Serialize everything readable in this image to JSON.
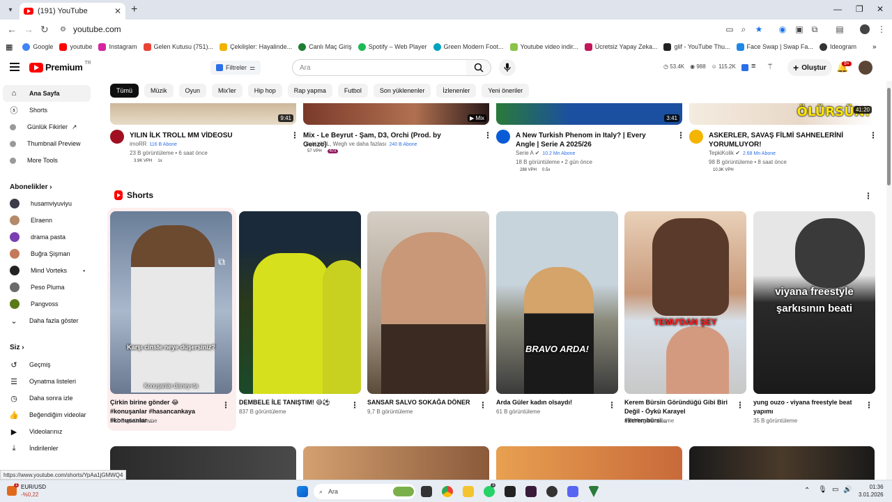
{
  "browser": {
    "tab_title": "(191) YouTube",
    "url": "youtube.com",
    "status_url": "https://www.youtube.com/shorts/YpAa1jGMWQ4",
    "bookmarks": [
      {
        "label": "Google",
        "color": "#4285f4"
      },
      {
        "label": "youtube",
        "color": "#ff0000"
      },
      {
        "label": "Instagram",
        "color": "#d6249f"
      },
      {
        "label": "Gelen Kutusu (751)...",
        "color": "#ea4335"
      },
      {
        "label": "Çekilişler: Hayalinde...",
        "color": "#f0b400"
      },
      {
        "label": "Canlı Maç Giriş",
        "color": "#1e7d32"
      },
      {
        "label": "Spotify – Web Player",
        "color": "#1db954"
      },
      {
        "label": "Green Modern Foot...",
        "color": "#00a3bf"
      },
      {
        "label": "Youtube video indir...",
        "color": "#8bc34a"
      },
      {
        "label": "Ücretsiz Yapay Zeka...",
        "color": "#c2185b"
      },
      {
        "label": "glif - YouTube Thu...",
        "color": "#222222"
      },
      {
        "label": "Face Swap | Swap Fa...",
        "color": "#1e88e5"
      },
      {
        "label": "Ideogram",
        "color": "#333333"
      }
    ]
  },
  "header": {
    "logo_text": "Premium",
    "logo_region": "TR",
    "filters_label": "Filtreler",
    "search_placeholder": "Ara",
    "stats": [
      "53.4K",
      "988",
      "115.2K"
    ],
    "create_label": "Oluştur",
    "notif_count": "9+"
  },
  "sidebar": {
    "main": [
      {
        "label": "Ana Sayfa",
        "icon": "home-icon"
      },
      {
        "label": "Shorts",
        "icon": "shorts-icon"
      },
      {
        "label": "Günlük Fikirler",
        "icon": "ext-icon"
      },
      {
        "label": "Thumbnail Preview",
        "icon": "ext-icon"
      },
      {
        "label": "More Tools",
        "icon": "ext-icon"
      }
    ],
    "subs_header": "Abonelikler",
    "subs": [
      {
        "label": "husamviyuviyu",
        "color": "#3b3b4a"
      },
      {
        "label": "Elraenn",
        "color": "#b58a6a"
      },
      {
        "label": "drama pasta",
        "color": "#7a3fb0"
      },
      {
        "label": "Buğra Şişman",
        "color": "#c47a5a"
      },
      {
        "label": "Mind Vorteks",
        "color": "#222222"
      },
      {
        "label": "Peso Pluma",
        "color": "#6b6b6b"
      },
      {
        "label": "Pangvoss",
        "color": "#5a7a1a"
      }
    ],
    "show_more": "Daha fazla göster",
    "you_header": "Siz",
    "you": [
      {
        "label": "Geçmiş",
        "icon": "history-icon"
      },
      {
        "label": "Oynatma listeleri",
        "icon": "playlist-icon"
      },
      {
        "label": "Daha sonra izle",
        "icon": "clock-icon"
      },
      {
        "label": "Beğendiğim videolar",
        "icon": "like-icon"
      },
      {
        "label": "Videolarınız",
        "icon": "video-icon"
      },
      {
        "label": "İndirilenler",
        "icon": "download-icon"
      }
    ]
  },
  "chips": [
    "Tümü",
    "Müzik",
    "Oyun",
    "Mix'ler",
    "Hip hop",
    "Rap yapma",
    "Futbol",
    "Son yüklenenler",
    "İzlenenler",
    "Yeni öneriler"
  ],
  "videos": [
    {
      "title": "YILIN İLK TROLL MM VİDEOSU",
      "channel": "imoRR",
      "subs": "116 B Abone",
      "meta": "23 B görüntüleme • 6 saat önce",
      "vph": "3.9K VPH",
      "ratio": "1x",
      "duration": "9:41",
      "thumb": "#d8c9b0",
      "avatar": "#a01020"
    },
    {
      "title": "Mix - Le Beyrut - Şam, D3, Orchi (Prod. by Genzo)",
      "channel": "Orchi, APL, Wegh ve daha fazlası",
      "subs": "240 B Abone",
      "meta": "",
      "vph": "57 VPH",
      "ratio": "47x",
      "duration": "Mix",
      "thumb": "#8b4a3a",
      "avatar": ""
    },
    {
      "title": "A New Turkish Phenom in Italy? | Every Angle | Serie A 2025/26",
      "channel": "Serie A",
      "subs": "10.2 Mn Abone",
      "meta": "18 B görüntüleme • 2 gün önce",
      "vph": "288 VPH",
      "ratio": "0.5x",
      "duration": "3:41",
      "thumb": "#1b4fa0",
      "avatar": "#0a5bd6"
    },
    {
      "title": "ASKERLER, SAVAŞ FİLMİ SAHNELERİNİ YORUMLUYOR!",
      "channel": "TepkiKolik",
      "subs": "2.68 Mn Abone",
      "meta": "98 B görüntüleme • 8 saat önce",
      "vph": "10.3K VPH",
      "ratio": "",
      "duration": "41:20",
      "thumb": "#f2e6d8",
      "avatar": "#f4b400",
      "overlay": "ÖLÜRSÜN!"
    }
  ],
  "shorts_title": "Shorts",
  "shorts": [
    {
      "title": "Çirkin birine gönder 😂 #konuşanlar #hasancankaya #konusanlar ...",
      "views": "301 B görüntüleme",
      "caption": "Karşı cinste neye düşersiniz?",
      "bg": "#8da0b8"
    },
    {
      "title": "DEMBELE İLE TANIŞTIM! 😅⚽",
      "views": "837 B görüntüleme",
      "caption": "",
      "bg": "#3a4a22"
    },
    {
      "title": "SANSAR SALVO SOKAĞA DÖNER",
      "views": "9,7 B görüntüleme",
      "caption": "",
      "bg": "#b8a89a"
    },
    {
      "title": "Arda Güler kadın olsaydı!",
      "views": "61 B görüntüleme",
      "caption": "BRAVO ARDA!",
      "bg": "#9aa8b0"
    },
    {
      "title": "Kerem Bürsin Göründüğü Gibi Biri Değil - Öykü Karayel #kerembürsi...",
      "views": "1,2 Mn görüntüleme",
      "caption": "TEMU'DAN ŞEY",
      "bg": "#c9a080"
    },
    {
      "title": "yung ouzo - viyana freestyle beat yapımı",
      "views": "35 B görüntüleme",
      "caption": "viyana freestyle şarkısının beati",
      "bg": "#4a4a4a"
    }
  ],
  "short_caption_sub": "Konuşanlar disney+ta",
  "taskbar": {
    "fx_label": "EUR/USD",
    "fx_change": "-%0,22",
    "fx_badge": "1",
    "search_placeholder": "Ara",
    "time": "01:36",
    "date": "3.01.2026",
    "whatsapp_badge": "3"
  }
}
